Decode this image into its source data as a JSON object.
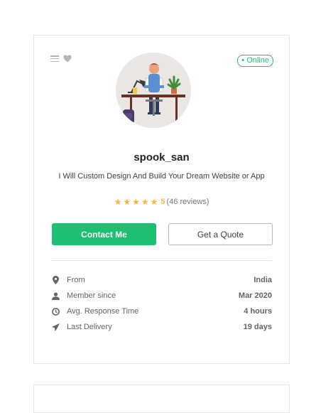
{
  "profile": {
    "status_badge": "• Online",
    "username": "spook_san",
    "tagline": "I Will Custom Design And Build Your Dream Website or App",
    "rating": {
      "stars": 5,
      "score": "5",
      "reviews": "(46 reviews)"
    }
  },
  "actions": {
    "contact_label": "Contact Me",
    "quote_label": "Get a Quote"
  },
  "stats": [
    {
      "icon": "location-pin-icon",
      "label": "From",
      "value": "India"
    },
    {
      "icon": "user-icon",
      "label": "Member since",
      "value": "Mar 2020"
    },
    {
      "icon": "clock-icon",
      "label": "Avg. Response Time",
      "value": "4 hours"
    },
    {
      "icon": "paper-plane-icon",
      "label": "Last Delivery",
      "value": "19 days"
    }
  ],
  "colors": {
    "accent": "#1dbf73",
    "star": "#ffb33e"
  }
}
